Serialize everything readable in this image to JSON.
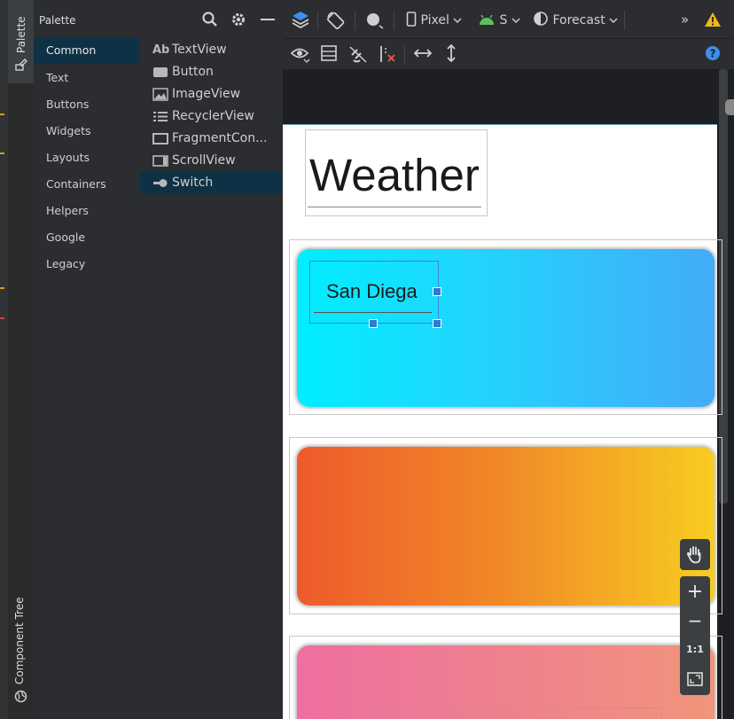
{
  "left_strip": {
    "palette_tab": "Palette",
    "component_tree_tab": "Component Tree"
  },
  "palette": {
    "title": "Palette",
    "categories": [
      "Common",
      "Text",
      "Buttons",
      "Widgets",
      "Layouts",
      "Containers",
      "Helpers",
      "Google",
      "Legacy"
    ],
    "selected_category": "Common",
    "widgets": [
      {
        "label": "TextView",
        "icon": "textview-icon"
      },
      {
        "label": "Button",
        "icon": "button-icon"
      },
      {
        "label": "ImageView",
        "icon": "imageview-icon"
      },
      {
        "label": "RecyclerView",
        "icon": "recyclerview-icon"
      },
      {
        "label": "FragmentCon...",
        "icon": "fragmentcontainer-icon"
      },
      {
        "label": "ScrollView",
        "icon": "scrollview-icon"
      },
      {
        "label": "Switch",
        "icon": "switch-icon"
      }
    ],
    "textview_prefix": "Ab",
    "selected_widget": "Switch"
  },
  "toolbar": {
    "device": "Pixel",
    "api": "S",
    "theme": "Forecast",
    "overflow": "»"
  },
  "canvas": {
    "title_text": "Weather",
    "city_text": "San Diega"
  },
  "zoom": {
    "plus": "+",
    "minus": "−",
    "one_to_one": "1:1"
  },
  "colors": {
    "selection": "#2b7bd7",
    "warning": "#f2b71d",
    "help": "#3d8ff0",
    "android_green": "#5fc05f"
  }
}
